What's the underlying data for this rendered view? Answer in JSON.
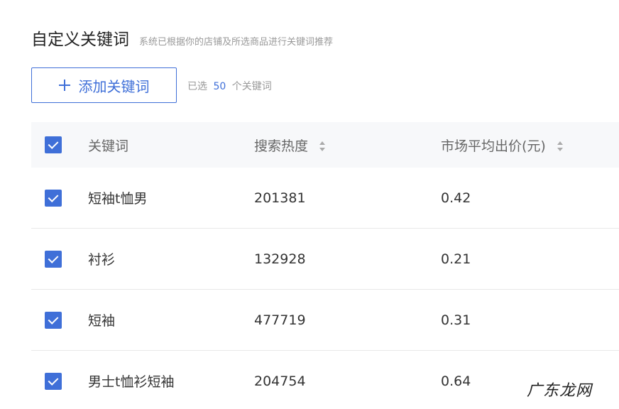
{
  "header": {
    "title": "自定义关键词",
    "subtitle": "系统已根据你的店铺及所选商品进行关键词推荐"
  },
  "toolbar": {
    "add_label": "添加关键词",
    "selected_prefix": "已选",
    "selected_count": "50",
    "selected_suffix": "个关键词"
  },
  "table": {
    "columns": {
      "keyword": "关键词",
      "heat": "搜索热度",
      "price": "市场平均出价(元)"
    },
    "rows": [
      {
        "keyword": "短袖t恤男",
        "heat": "201381",
        "price": "0.42"
      },
      {
        "keyword": "衬衫",
        "heat": "132928",
        "price": "0.21"
      },
      {
        "keyword": "短袖",
        "heat": "477719",
        "price": "0.31"
      },
      {
        "keyword": "男士t恤衫短袖",
        "heat": "204754",
        "price": "0.64"
      }
    ]
  },
  "watermark": "广东龙网",
  "colors": {
    "accent": "#3f6fd8",
    "header_bg": "#f7f8fa"
  }
}
